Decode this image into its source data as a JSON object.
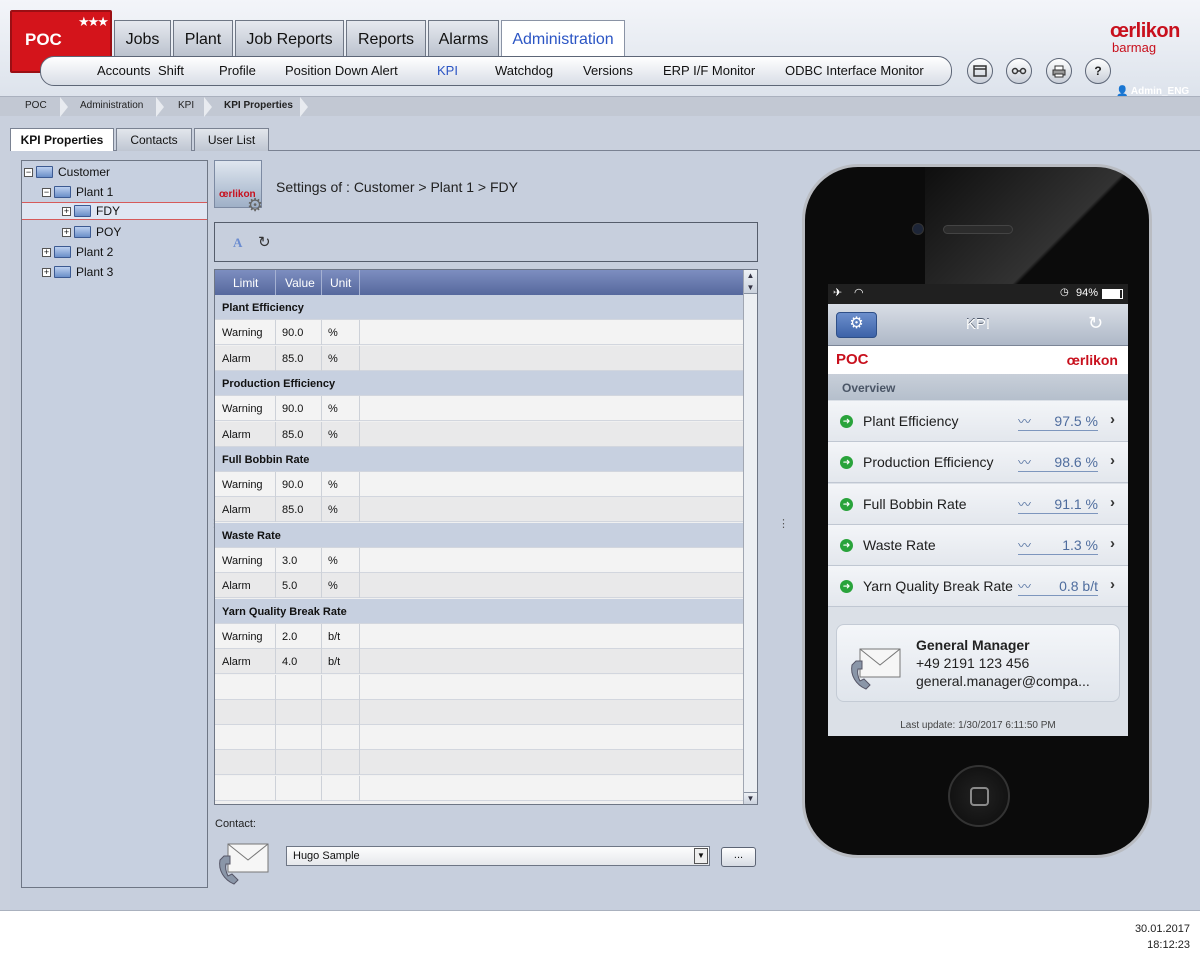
{
  "header": {
    "brand": "POC",
    "stars": "★★★",
    "main_tabs": [
      {
        "label": "Jobs"
      },
      {
        "label": "Plant"
      },
      {
        "label": "Job Reports"
      },
      {
        "label": "Reports"
      },
      {
        "label": "Alarms"
      },
      {
        "label": "Administration"
      }
    ],
    "sub_tabs": [
      {
        "label": "Accounts"
      },
      {
        "label": "Shift"
      },
      {
        "label": "Profile"
      },
      {
        "label": "Position Down Alert"
      },
      {
        "label": "KPI"
      },
      {
        "label": "Watchdog"
      },
      {
        "label": "Versions"
      },
      {
        "label": "ERP I/F Monitor"
      },
      {
        "label": "ODBC Interface Monitor"
      }
    ],
    "tool_icons": [
      "window-icon",
      "connection-icon",
      "print-icon",
      "help-icon"
    ],
    "help_glyph": "?",
    "logo": "œrlikon",
    "logo_sub": "barmag",
    "user": "Admin_ENG"
  },
  "breadcrumb": [
    "POC",
    "Administration",
    "KPI",
    "KPI Properties"
  ],
  "inner_tabs": [
    {
      "label": "KPI Properties"
    },
    {
      "label": "Contacts"
    },
    {
      "label": "User List"
    }
  ],
  "tree": {
    "root": "Customer",
    "plant1": "Plant 1",
    "fdy": "FDY",
    "poy": "POY",
    "plant2": "Plant 2",
    "plant3": "Plant 3"
  },
  "settings": {
    "icon_text": "œrlikon",
    "title": "Settings of : Customer > Plant 1 > FDY"
  },
  "grid": {
    "headers": {
      "limit": "Limit",
      "value": "Value",
      "unit": "Unit"
    },
    "groups": [
      {
        "name": "Plant Efficiency",
        "rows": [
          {
            "limit": "Warning",
            "value": "90.0",
            "unit": "%"
          },
          {
            "limit": "Alarm",
            "value": "85.0",
            "unit": "%"
          }
        ]
      },
      {
        "name": "Production Efficiency",
        "rows": [
          {
            "limit": "Warning",
            "value": "90.0",
            "unit": "%"
          },
          {
            "limit": "Alarm",
            "value": "85.0",
            "unit": "%"
          }
        ]
      },
      {
        "name": "Full Bobbin Rate",
        "rows": [
          {
            "limit": "Warning",
            "value": "90.0",
            "unit": "%"
          },
          {
            "limit": "Alarm",
            "value": "85.0",
            "unit": "%"
          }
        ]
      },
      {
        "name": "Waste Rate",
        "rows": [
          {
            "limit": "Warning",
            "value": "3.0",
            "unit": "%"
          },
          {
            "limit": "Alarm",
            "value": "5.0",
            "unit": "%"
          }
        ]
      },
      {
        "name": "Yarn Quality Break Rate",
        "rows": [
          {
            "limit": "Warning",
            "value": "2.0",
            "unit": "b/t"
          },
          {
            "limit": "Alarm",
            "value": "4.0",
            "unit": "b/t"
          }
        ]
      }
    ]
  },
  "contact": {
    "label": "Contact:",
    "selected": "Hugo Sample",
    "more_button": "..."
  },
  "phone": {
    "status_battery": "94%",
    "nav_title": "KPI",
    "brand_left": "POC",
    "brand_right": "œrlikon",
    "section": "Overview",
    "kpis": [
      {
        "name": "Plant Efficiency",
        "value": "97.5 %"
      },
      {
        "name": "Production Efficiency",
        "value": "98.6 %"
      },
      {
        "name": "Full Bobbin Rate",
        "value": "91.1 %"
      },
      {
        "name": "Waste Rate",
        "value": "1.3 %"
      },
      {
        "name": "Yarn Quality Break Rate",
        "value": "0.8 b/t"
      }
    ],
    "manager": {
      "title": "General Manager",
      "phone": "+49 2191 123 456",
      "email": "general.manager@compa..."
    },
    "last_update": "Last update: 1/30/2017 6:11:50 PM"
  },
  "footer": {
    "date": "30.01.2017",
    "time": "18:12:23"
  }
}
